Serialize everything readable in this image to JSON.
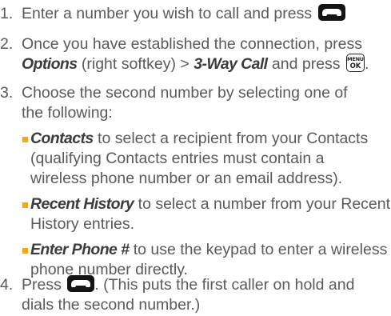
{
  "steps": [
    {
      "number": "1.",
      "line1": "Enter a number you wish to call and press",
      "key": "talk-key"
    },
    {
      "number": "2.",
      "line1": "Once you have established the connection, press",
      "options": "Options",
      "options_suffix": " (right softkey) > ",
      "threeway": "3-Way Call",
      "and_press": " and press",
      "key": "menu-ok-key",
      "key_label_top": "MENU",
      "key_label_bottom": "OK"
    },
    {
      "number": "3.",
      "line1": "Choose the second number by selecting one of",
      "line2": "the following:",
      "bullets": [
        {
          "term": "Contacts",
          "lines": [
            " to select a recipient from your Contacts",
            "(qualifying Contacts entries must contain a",
            "wireless phone number or an email address)."
          ]
        },
        {
          "term": "Recent History",
          "lines": [
            " to select a number from your Recent",
            "History entries."
          ]
        },
        {
          "term": "Enter Phone #",
          "lines": [
            " to use the keypad to enter a wireless",
            "phone number directly."
          ]
        }
      ]
    },
    {
      "number": "4.",
      "press": "Press",
      "key": "talk-key",
      "line1_rest": ". (This puts the first caller on hold and",
      "line2": "dials the second number.)"
    }
  ],
  "colors": {
    "text": "#5a5a5a",
    "emphasis": "#3c3c3c",
    "bullet": "#f0a81c",
    "key": "#141414"
  }
}
